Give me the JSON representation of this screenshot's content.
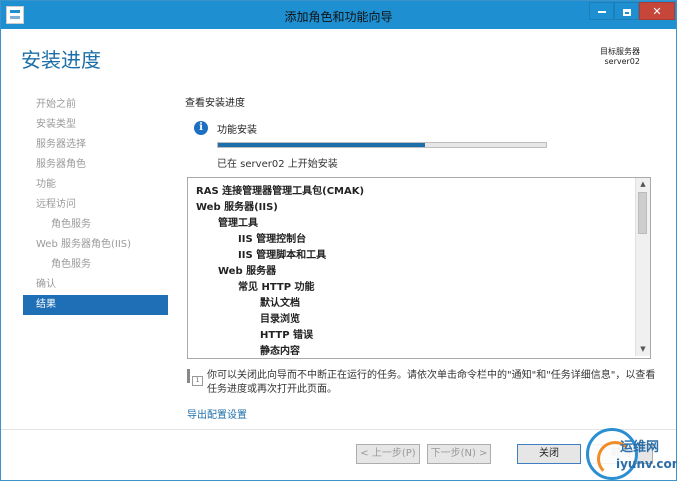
{
  "window": {
    "title": "添加角色和功能向导",
    "controls": {
      "minimize": "",
      "maximize": "",
      "close": "✕"
    }
  },
  "header": {
    "page_title": "安装进度",
    "destination_label": "目标服务器",
    "destination_value": "server02"
  },
  "nav": {
    "items": [
      {
        "label": "开始之前",
        "indent": 0,
        "active": false
      },
      {
        "label": "安装类型",
        "indent": 0,
        "active": false
      },
      {
        "label": "服务器选择",
        "indent": 0,
        "active": false
      },
      {
        "label": "服务器角色",
        "indent": 0,
        "active": false
      },
      {
        "label": "功能",
        "indent": 0,
        "active": false
      },
      {
        "label": "远程访问",
        "indent": 0,
        "active": false
      },
      {
        "label": "角色服务",
        "indent": 1,
        "active": false
      },
      {
        "label": "Web 服务器角色(IIS)",
        "indent": 0,
        "active": false
      },
      {
        "label": "角色服务",
        "indent": 1,
        "active": false
      },
      {
        "label": "确认",
        "indent": 0,
        "active": false
      },
      {
        "label": "结果",
        "indent": 0,
        "active": true
      }
    ]
  },
  "content": {
    "section_title": "查看安装进度",
    "progress": {
      "label": "功能安装",
      "value": 0.63,
      "status": "已在 server02 上开始安装"
    },
    "list": [
      {
        "text": "RAS 连接管理器管理工具包(CMAK)",
        "level": 0
      },
      {
        "text": "Web 服务器(IIS)",
        "level": 0
      },
      {
        "text": "管理工具",
        "level": 1
      },
      {
        "text": "IIS 管理控制台",
        "level": 2
      },
      {
        "text": "IIS 管理脚本和工具",
        "level": 2
      },
      {
        "text": "Web 服务器",
        "level": 1
      },
      {
        "text": "常见 HTTP 功能",
        "level": 2
      },
      {
        "text": "默认文档",
        "level": 3
      },
      {
        "text": "目录浏览",
        "level": 3
      },
      {
        "text": "HTTP 错误",
        "level": 3
      },
      {
        "text": "静态内容",
        "level": 3
      }
    ],
    "note": "你可以关闭此向导而不中断正在运行的任务。请依次单击命令栏中的\"通知\"和\"任务详细信息\"，以查看任务进度或再次打开此页面。",
    "export_link": "导出配置设置"
  },
  "footer": {
    "prev_label": "< 上一步(P)",
    "next_label": "下一步(N) >",
    "close_label": "关闭",
    "cancel_label": "取消"
  },
  "watermark": {
    "cn": "运维网",
    "url": "iyunv.com"
  },
  "colors": {
    "titlebar": "#1e90d2",
    "accent": "#1c6fa8",
    "nav_active": "#1e6fb5",
    "close_button": "#c7463a"
  }
}
